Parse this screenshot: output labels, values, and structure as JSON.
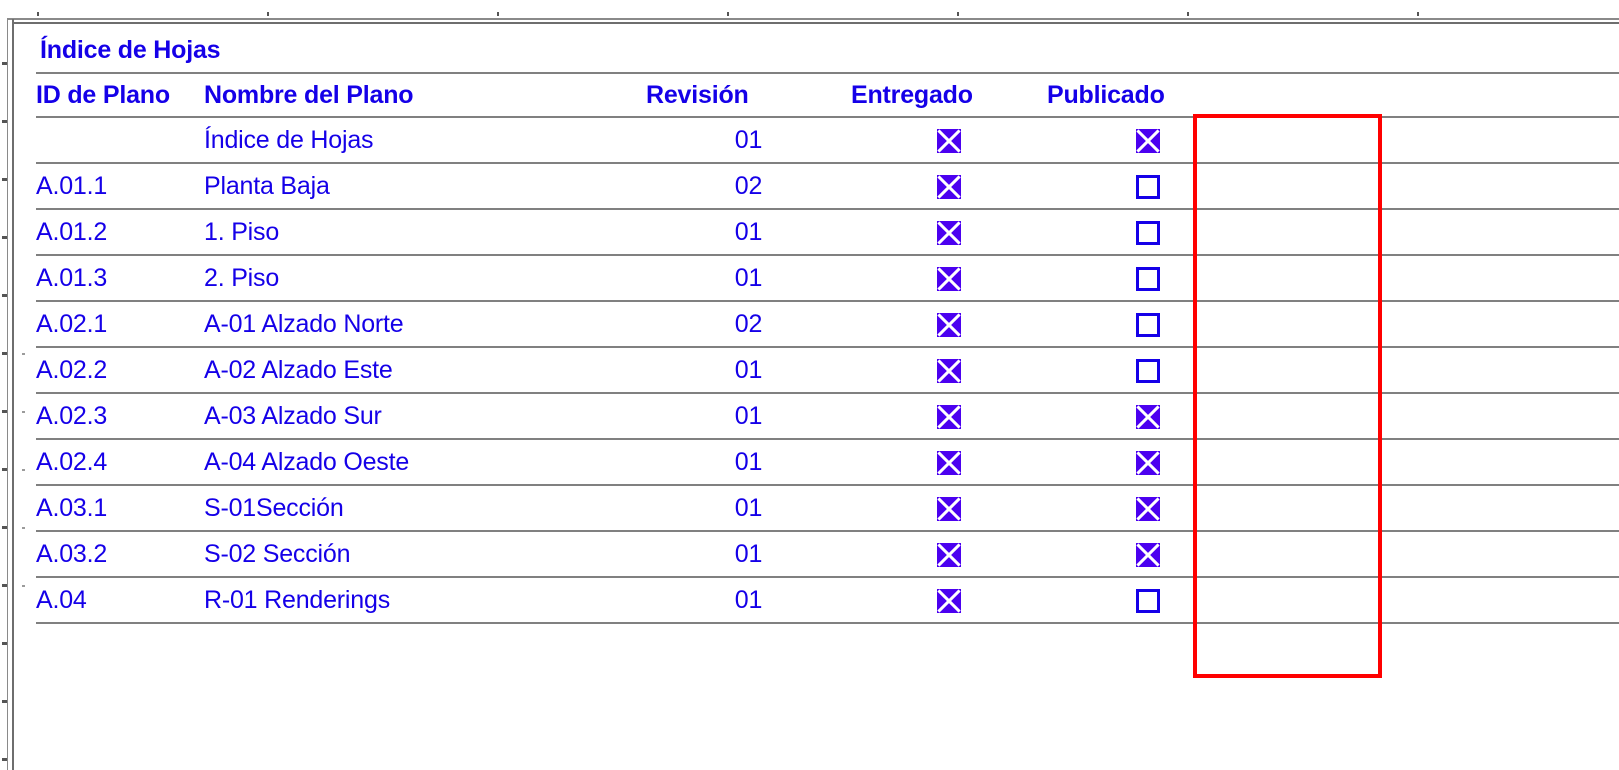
{
  "document": {
    "title": "Índice de Hojas",
    "text_color": "#1500e8",
    "rule_color": "#808080",
    "highlight_color": "#ff0000"
  },
  "table": {
    "columns": [
      {
        "key": "id",
        "label": "ID de Plano"
      },
      {
        "key": "name",
        "label": "Nombre del Plano"
      },
      {
        "key": "revision",
        "label": "Revisión"
      },
      {
        "key": "delivered",
        "label": "Entregado"
      },
      {
        "key": "published",
        "label": "Publicado"
      }
    ],
    "rows": [
      {
        "id": "",
        "name": "Índice de Hojas",
        "revision": "01",
        "delivered": true,
        "published": true
      },
      {
        "id": "A.01.1",
        "name": "Planta Baja",
        "revision": "02",
        "delivered": true,
        "published": false
      },
      {
        "id": "A.01.2",
        "name": "1. Piso",
        "revision": "01",
        "delivered": true,
        "published": false
      },
      {
        "id": "A.01.3",
        "name": "2. Piso",
        "revision": "01",
        "delivered": true,
        "published": false
      },
      {
        "id": "A.02.1",
        "name": "A-01 Alzado Norte",
        "revision": "02",
        "delivered": true,
        "published": false
      },
      {
        "id": "A.02.2",
        "name": "A-02 Alzado Este",
        "revision": "01",
        "delivered": true,
        "published": false
      },
      {
        "id": "A.02.3",
        "name": "A-03 Alzado Sur",
        "revision": "01",
        "delivered": true,
        "published": true
      },
      {
        "id": "A.02.4",
        "name": "A-04 Alzado Oeste",
        "revision": "01",
        "delivered": true,
        "published": true
      },
      {
        "id": "A.03.1",
        "name": "S-01Sección",
        "revision": "01",
        "delivered": true,
        "published": true
      },
      {
        "id": "A.03.2",
        "name": "S-02 Sección",
        "revision": "01",
        "delivered": true,
        "published": true
      },
      {
        "id": "A.04",
        "name": "R-01 Renderings",
        "revision": "01",
        "delivered": true,
        "published": false
      }
    ]
  },
  "annotation": {
    "name": "publicado-column-highlight",
    "target_column": "Publicado",
    "color": "#ff0000"
  }
}
